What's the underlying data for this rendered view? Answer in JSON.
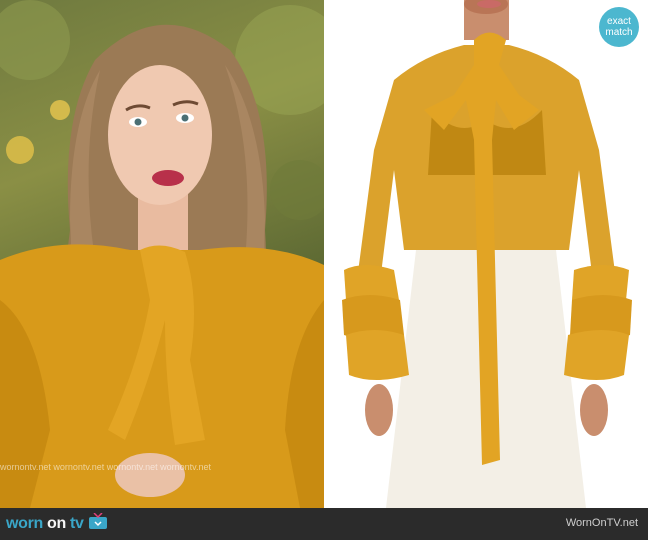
{
  "footer": {
    "logo_word1": "worn",
    "logo_word2": "on",
    "logo_word3": "tv",
    "site_label": "WornOnTV.net"
  },
  "badge": {
    "line1": "exact",
    "line2": "match"
  },
  "watermark": {
    "text": "wornontv.net  wornontv.net  wornontv.net  wornontv.net"
  },
  "colors": {
    "blouse_mustard": "#d89a1a",
    "badge_blue": "#4cb7cf",
    "footer_dark": "#2b2b2b"
  }
}
